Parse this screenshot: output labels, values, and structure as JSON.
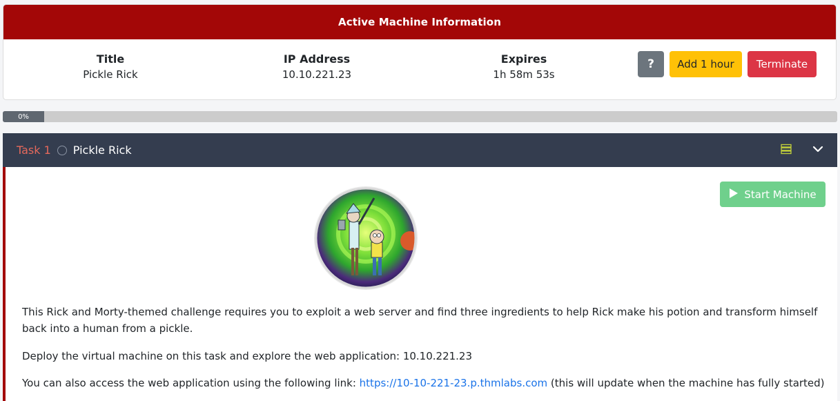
{
  "machine": {
    "header": "Active Machine Information",
    "title_label": "Title",
    "title_value": "Pickle Rick",
    "ip_label": "IP Address",
    "ip_value": "10.10.221.23",
    "expires_label": "Expires",
    "expires_value": "1h 58m 53s",
    "help_label": "?",
    "add_hour_label": "Add 1 hour",
    "terminate_label": "Terminate"
  },
  "progress": {
    "label": "0%",
    "value": 0
  },
  "task": {
    "number": "Task 1",
    "title": "Pickle Rick",
    "start_machine_label": "Start Machine",
    "paragraph1": "This Rick and Morty-themed challenge requires you to exploit a web server and find three ingredients to help Rick make his potion and transform himself back into a human from a pickle.",
    "paragraph2": "Deploy the virtual machine on this task and explore the web application: 10.10.221.23",
    "paragraph3_prefix": "You can also access the web application using the following link: ",
    "paragraph3_link": "https://10-10-221-23.p.thmlabs.com",
    "paragraph3_suffix": " (this will update when the machine has fully started)"
  },
  "icons": {
    "list": "list-icon",
    "chevron": "chevron-down-icon",
    "play": "play-icon",
    "task_status": "circle-icon"
  },
  "colors": {
    "header_red": "#a30707",
    "task_header": "#343d4f",
    "add_hour": "#ffc107",
    "terminate": "#dc3545",
    "start_machine": "#6fd08c",
    "link": "#1a73e8"
  }
}
